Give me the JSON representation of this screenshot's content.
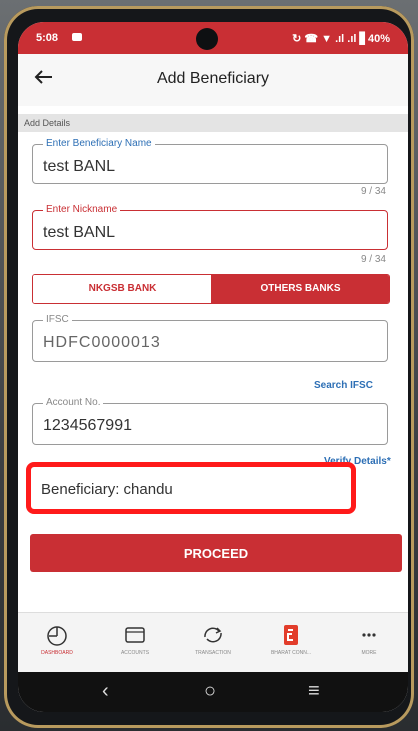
{
  "status": {
    "time": "5:08",
    "right": "↻ ☎ ▼ .ıl .ıl ▋40%"
  },
  "header": {
    "title": "Add Beneficiary"
  },
  "section": {
    "label": "Add Details"
  },
  "fields": {
    "name": {
      "label": "Enter Beneficiary Name",
      "value": "test BANL",
      "counter": "9 / 34"
    },
    "nickname": {
      "label": "Enter Nickname",
      "value": "test BANL",
      "counter": "9 / 34"
    },
    "ifsc": {
      "label": "IFSC",
      "value": "HDFC0000013"
    },
    "account": {
      "label": "Account No.",
      "value": "1234567991"
    }
  },
  "toggle": {
    "left": "NKGSB BANK",
    "right": "OTHERS BANKS"
  },
  "links": {
    "search_ifsc": "Search IFSC",
    "verify_details": "Verify Details*"
  },
  "beneficiary": {
    "text": "Beneficiary: chandu"
  },
  "actions": {
    "proceed": "PROCEED"
  },
  "nav": [
    {
      "label": "DASHBOARD",
      "icon": "dashboard-icon"
    },
    {
      "label": "ACCOUNTS",
      "icon": "wallet-icon"
    },
    {
      "label": "TRANSACTION",
      "icon": "transfer-icon"
    },
    {
      "label": "BHARAT CONN...",
      "icon": "bharat-connect-icon"
    },
    {
      "label": "MORE",
      "icon": "more-icon"
    }
  ],
  "colors": {
    "brand": "#c92f34",
    "link": "#2d6fb5",
    "highlight": "#ff1a1a"
  }
}
